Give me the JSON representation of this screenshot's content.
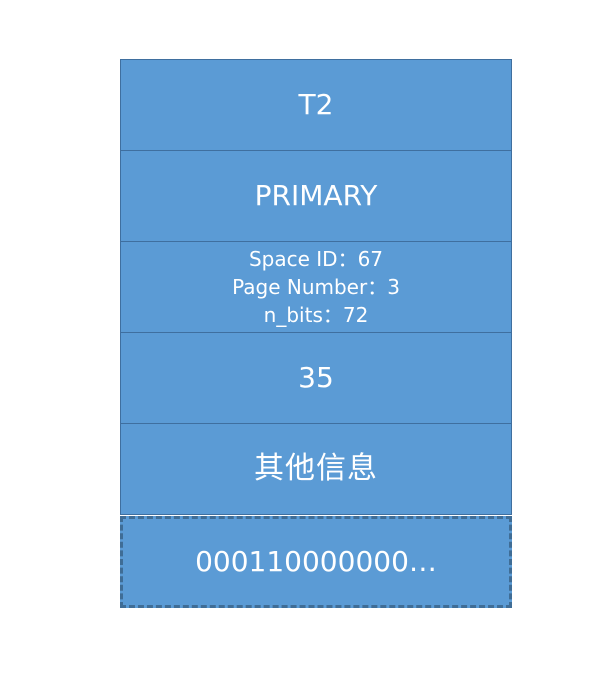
{
  "record": {
    "table_name": "T2",
    "index_name": "PRIMARY",
    "space_id": "Space ID：67",
    "page_number": "Page Number：3",
    "n_bits": "n_bits：72",
    "value": "35",
    "other_info": "其他信息",
    "bitmap": "000110000000…"
  }
}
